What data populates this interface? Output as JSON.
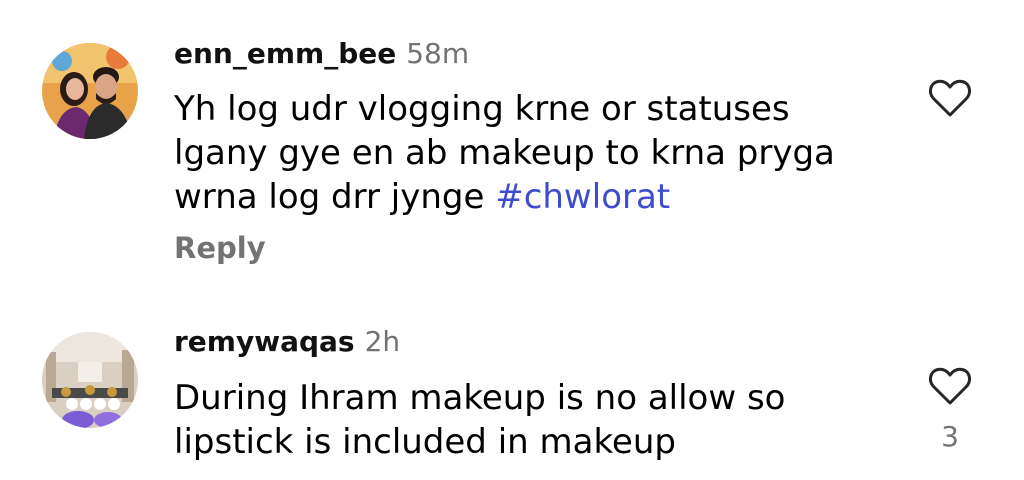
{
  "comments": [
    {
      "username": "enn_emm_bee",
      "time": "58m",
      "lines": [
        "Yh log udr vlogging krne or statuses",
        "lgany gye en ab makeup to krna pryga",
        "wrna log drr jynge "
      ],
      "hashtag": "#chwlorat",
      "reply_label": "Reply",
      "like_icon": "heart-outline-icon"
    },
    {
      "username": "remywaqas",
      "time": "2h",
      "lines": [
        "During Ihram makeup is no allow so",
        "lipstick is included in makeup"
      ],
      "like_count": "3",
      "like_icon": "heart-outline-icon"
    }
  ],
  "colors": {
    "hashtag": "#3f4dcc",
    "muted": "#737373"
  }
}
